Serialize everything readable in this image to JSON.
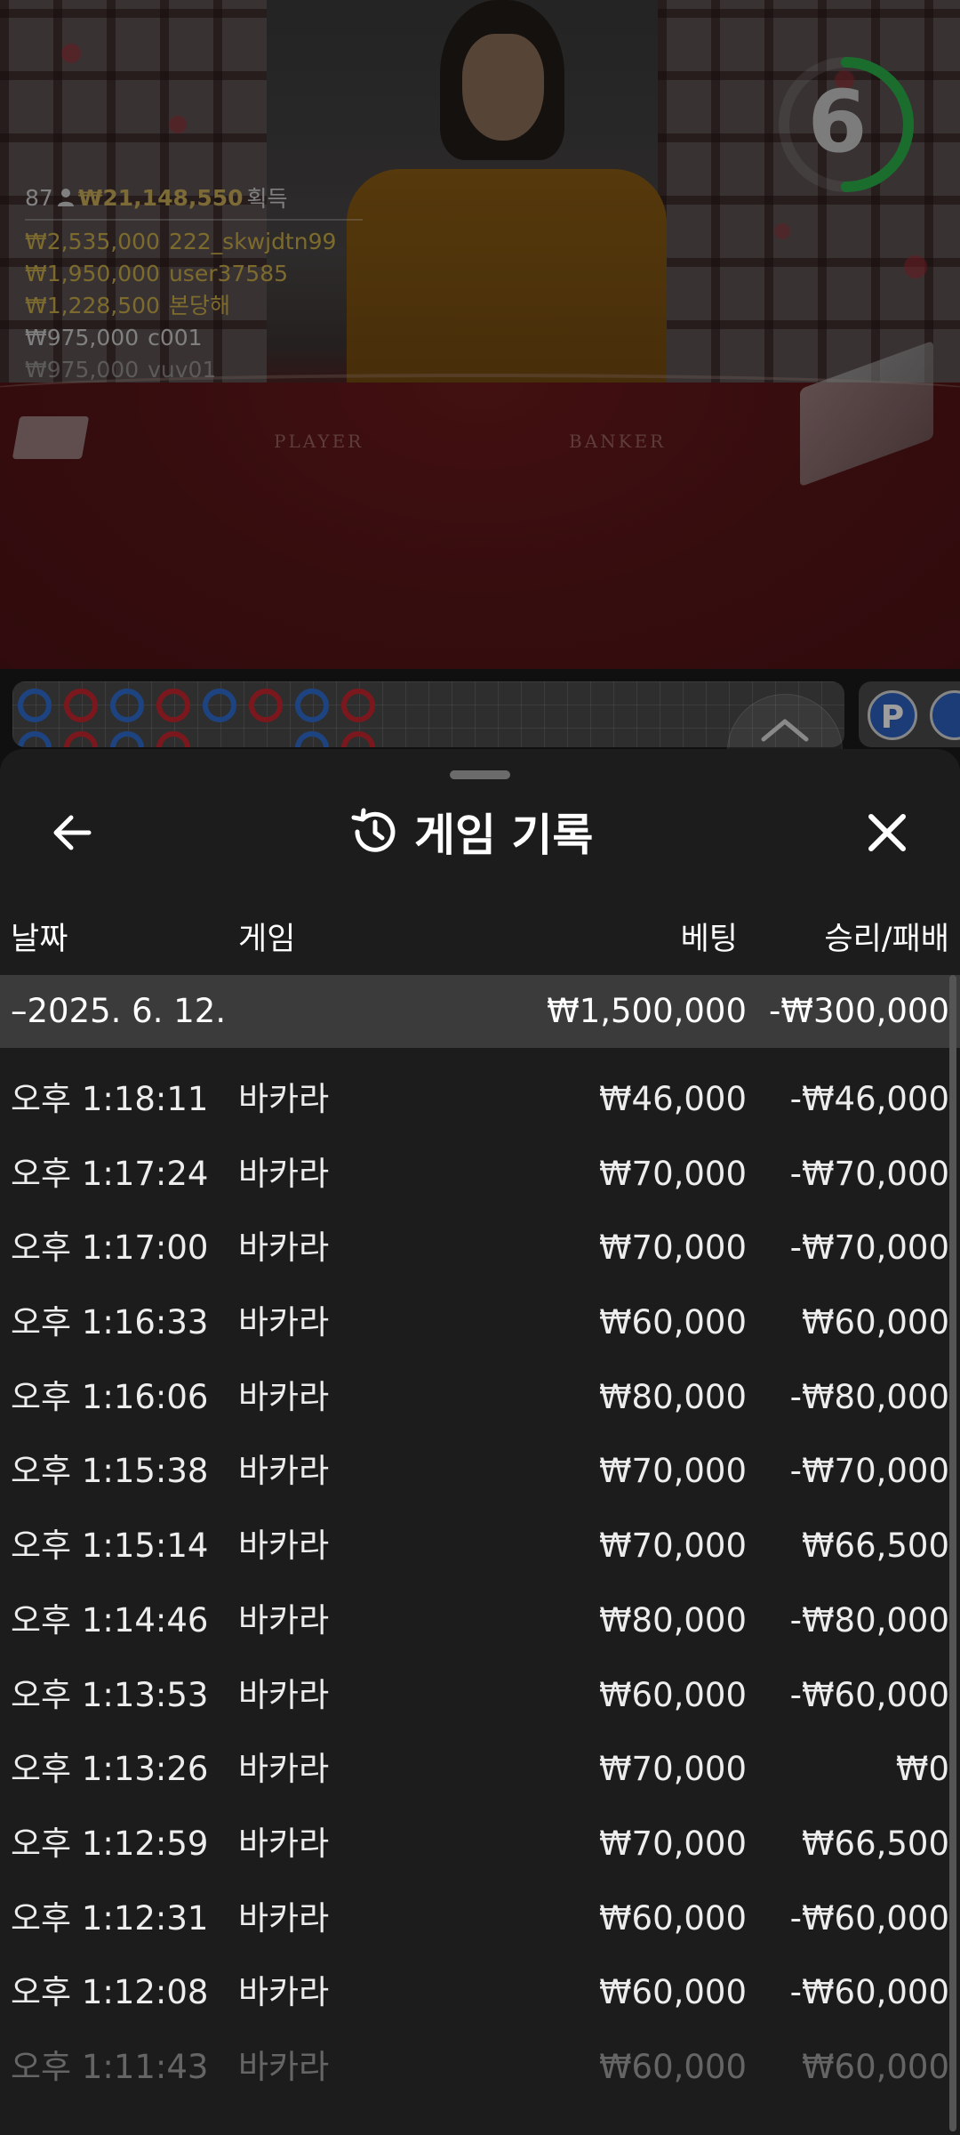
{
  "video": {
    "table_left_text": "PLAYER",
    "table_right_text": "BANKER",
    "timer": "6",
    "winners": {
      "count": "87",
      "total": "₩21,148,550",
      "total_label": "획득",
      "list": [
        {
          "amount": "₩2,535,000",
          "user": "222_skwjdtn99"
        },
        {
          "amount": "₩1,950,000",
          "user": "user37585"
        },
        {
          "amount": "₩1,228,500",
          "user": "본당해"
        },
        {
          "amount": "₩975,000",
          "user": "c001"
        },
        {
          "amount": "₩975,000",
          "user": "vuv01"
        }
      ]
    }
  },
  "roadmap": {
    "button_label": "P"
  },
  "sheet": {
    "title": "게임 기록",
    "columns": {
      "date": "날짜",
      "game": "게임",
      "bet": "베팅",
      "win_loss": "승리/패배"
    },
    "group": {
      "date": "–2025. 6. 12.",
      "bet": "₩1,500,000",
      "win_loss": "-₩300,000"
    },
    "rows": [
      {
        "time": "오후 1:18:11",
        "game": "바카라",
        "bet": "₩46,000",
        "result": "-₩46,000"
      },
      {
        "time": "오후 1:17:24",
        "game": "바카라",
        "bet": "₩70,000",
        "result": "-₩70,000"
      },
      {
        "time": "오후 1:17:00",
        "game": "바카라",
        "bet": "₩70,000",
        "result": "-₩70,000"
      },
      {
        "time": "오후 1:16:33",
        "game": "바카라",
        "bet": "₩60,000",
        "result": "₩60,000"
      },
      {
        "time": "오후 1:16:06",
        "game": "바카라",
        "bet": "₩80,000",
        "result": "-₩80,000"
      },
      {
        "time": "오후 1:15:38",
        "game": "바카라",
        "bet": "₩70,000",
        "result": "-₩70,000"
      },
      {
        "time": "오후 1:15:14",
        "game": "바카라",
        "bet": "₩70,000",
        "result": "₩66,500"
      },
      {
        "time": "오후 1:14:46",
        "game": "바카라",
        "bet": "₩80,000",
        "result": "-₩80,000"
      },
      {
        "time": "오후 1:13:53",
        "game": "바카라",
        "bet": "₩60,000",
        "result": "-₩60,000"
      },
      {
        "time": "오후 1:13:26",
        "game": "바카라",
        "bet": "₩70,000",
        "result": "₩0"
      },
      {
        "time": "오후 1:12:59",
        "game": "바카라",
        "bet": "₩70,000",
        "result": "₩66,500"
      },
      {
        "time": "오후 1:12:31",
        "game": "바카라",
        "bet": "₩60,000",
        "result": "-₩60,000"
      },
      {
        "time": "오후 1:12:08",
        "game": "바카라",
        "bet": "₩60,000",
        "result": "-₩60,000"
      },
      {
        "time": "오후 1:11:43",
        "game": "바카라",
        "bet": "₩60,000",
        "result": "₩60,000"
      }
    ]
  }
}
